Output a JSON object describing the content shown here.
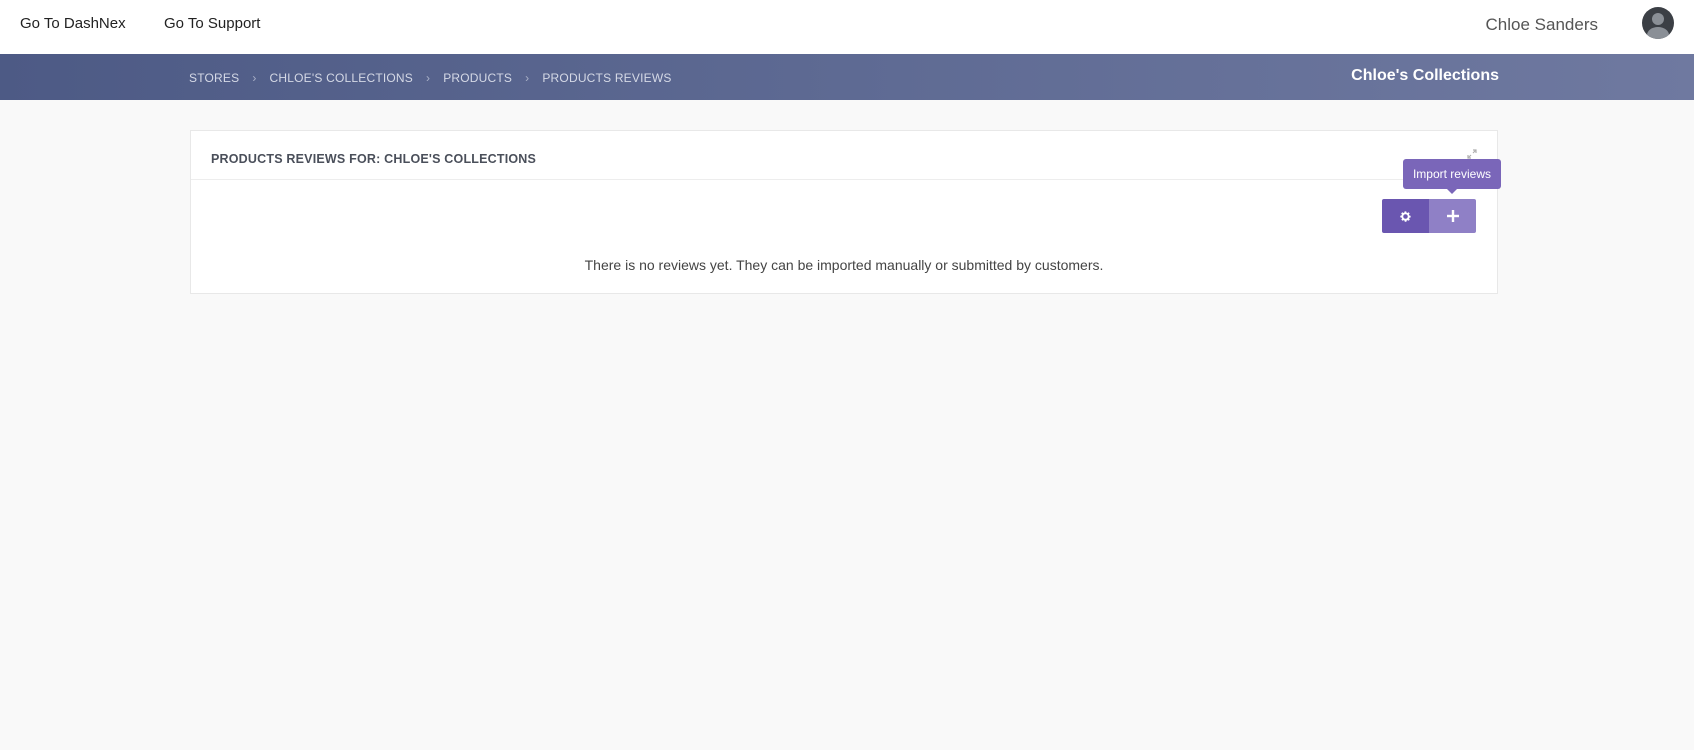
{
  "topbar": {
    "link1": "Go To DashNex",
    "link2": "Go To Support",
    "user_name": "Chloe Sanders"
  },
  "breadcrumb": {
    "items": [
      "Stores",
      "Chloe's Collections",
      "Products",
      "Products Reviews"
    ],
    "store_title": "Chloe's Collections"
  },
  "panel": {
    "title": "PRODUCTS REVIEWS FOR: CHLOE'S COLLECTIONS",
    "tooltip": "Import reviews",
    "empty_message": "There is no reviews yet. They can be imported manually or submitted by customers."
  },
  "colors": {
    "accent": "#6a56b0",
    "accent_light": "#8f80c6",
    "band_start": "#4d5a85",
    "band_end": "#6f79a0"
  },
  "icons": [
    "user-avatar-icon",
    "chevron-right-icon",
    "expand-icon",
    "gear-icon",
    "plus-icon"
  ]
}
